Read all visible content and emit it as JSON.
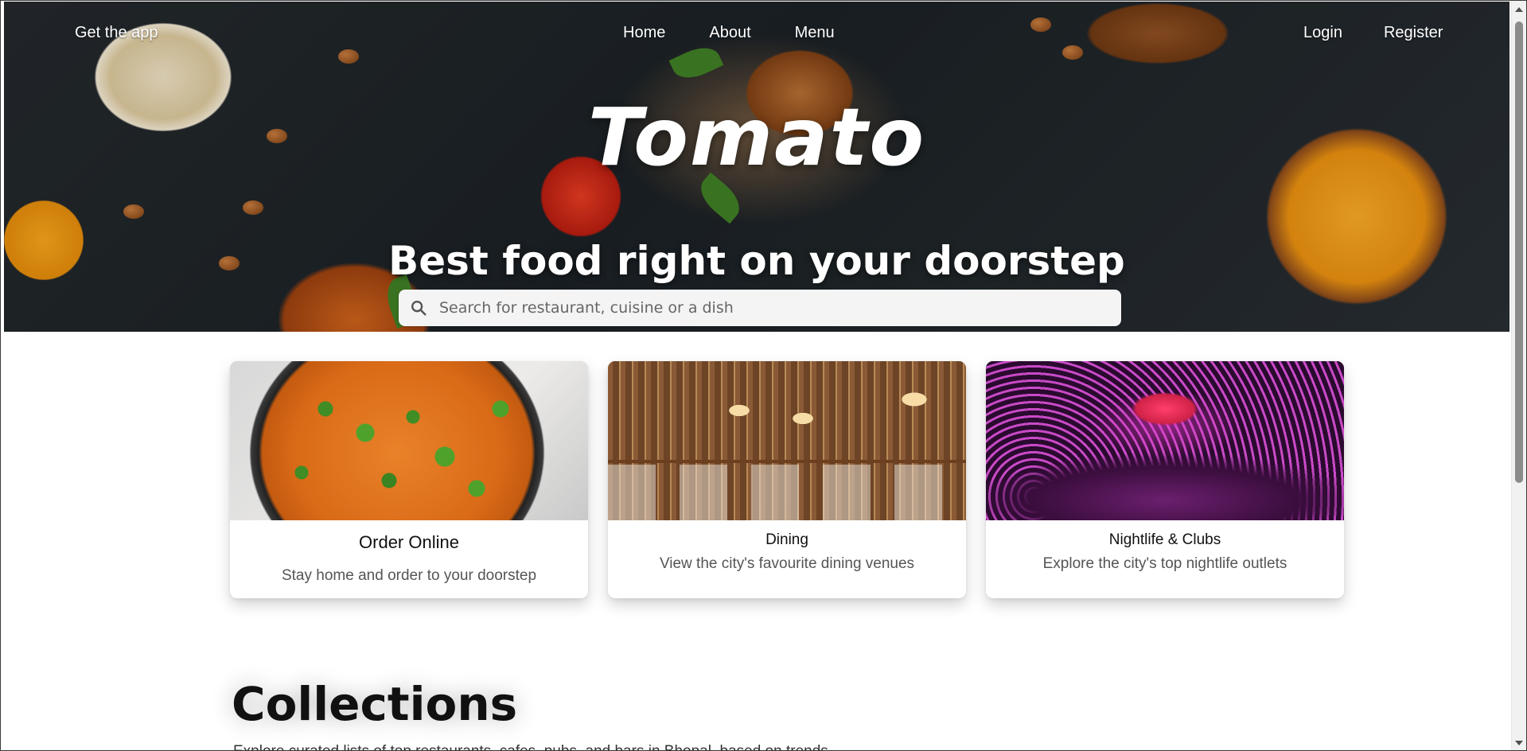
{
  "nav": {
    "get_app": "Get the app",
    "links": [
      "Home",
      "About",
      "Menu"
    ],
    "login": "Login",
    "register": "Register"
  },
  "hero": {
    "brand": "Tomato",
    "tagline": "Best food right on your doorstep",
    "search_placeholder": "Search for restaurant, cuisine or a dish",
    "search_icon": "search-icon"
  },
  "cards": [
    {
      "title": "Order Online",
      "description": "Stay home and order to your doorstep"
    },
    {
      "title": "Dining",
      "description": "View the city's favourite dining venues"
    },
    {
      "title": "Nightlife & Clubs",
      "description": "Explore the city's top nightlife outlets"
    }
  ],
  "collections": {
    "title": "Collections",
    "description": "Explore curated lists of top restaurants, cafes, pubs, and bars in Bhopal, based on trends"
  },
  "colors": {
    "accent": "#ffffff",
    "text": "#111111",
    "muted": "#555555",
    "search_bg": "#f4f4f4"
  }
}
